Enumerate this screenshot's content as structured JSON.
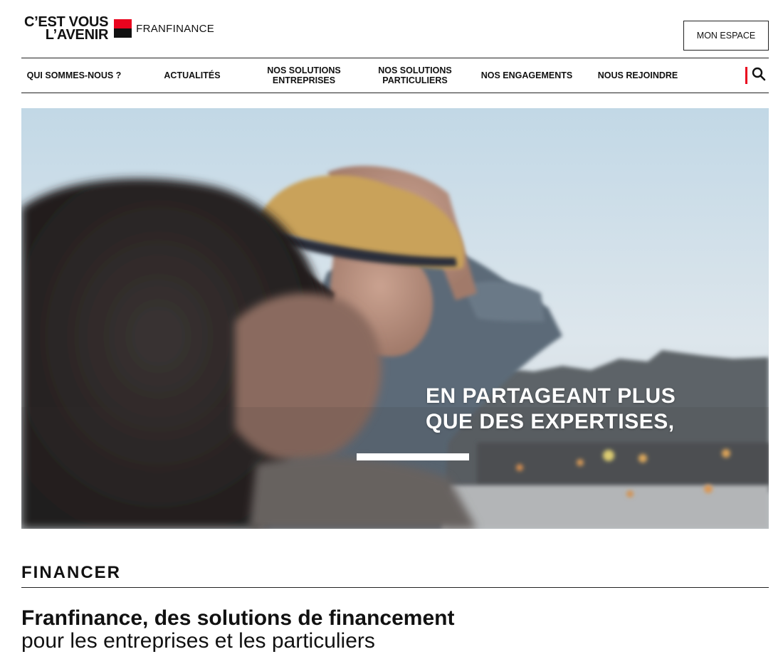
{
  "header": {
    "tagline_line1": "C’EST VOUS",
    "tagline_line2": "L’AVENIR",
    "brand": "FRANFINANCE",
    "account_button": "MON ESPACE"
  },
  "nav": {
    "items": [
      {
        "line1": "QUI SOMMES-NOUS ?",
        "line2": ""
      },
      {
        "line1": "ACTUALITÉS",
        "line2": ""
      },
      {
        "line1": "NOS SOLUTIONS",
        "line2": "ENTREPRISES"
      },
      {
        "line1": "NOS SOLUTIONS",
        "line2": "PARTICULIERS"
      },
      {
        "line1": "NOS ENGAGEMENTS",
        "line2": ""
      },
      {
        "line1": "NOUS REJOINDRE",
        "line2": ""
      }
    ],
    "search_icon": "search-icon"
  },
  "hero": {
    "caption_line1": "EN PARTAGEANT PLUS",
    "caption_line2": "QUE DES EXPERTISES,"
  },
  "section": {
    "title": "FINANCER",
    "headline_strong": "Franfinance, des solutions de financement",
    "headline_light": "pour les entreprises et les particuliers"
  },
  "colors": {
    "brand_red": "#e9041e",
    "brand_black": "#111111"
  }
}
